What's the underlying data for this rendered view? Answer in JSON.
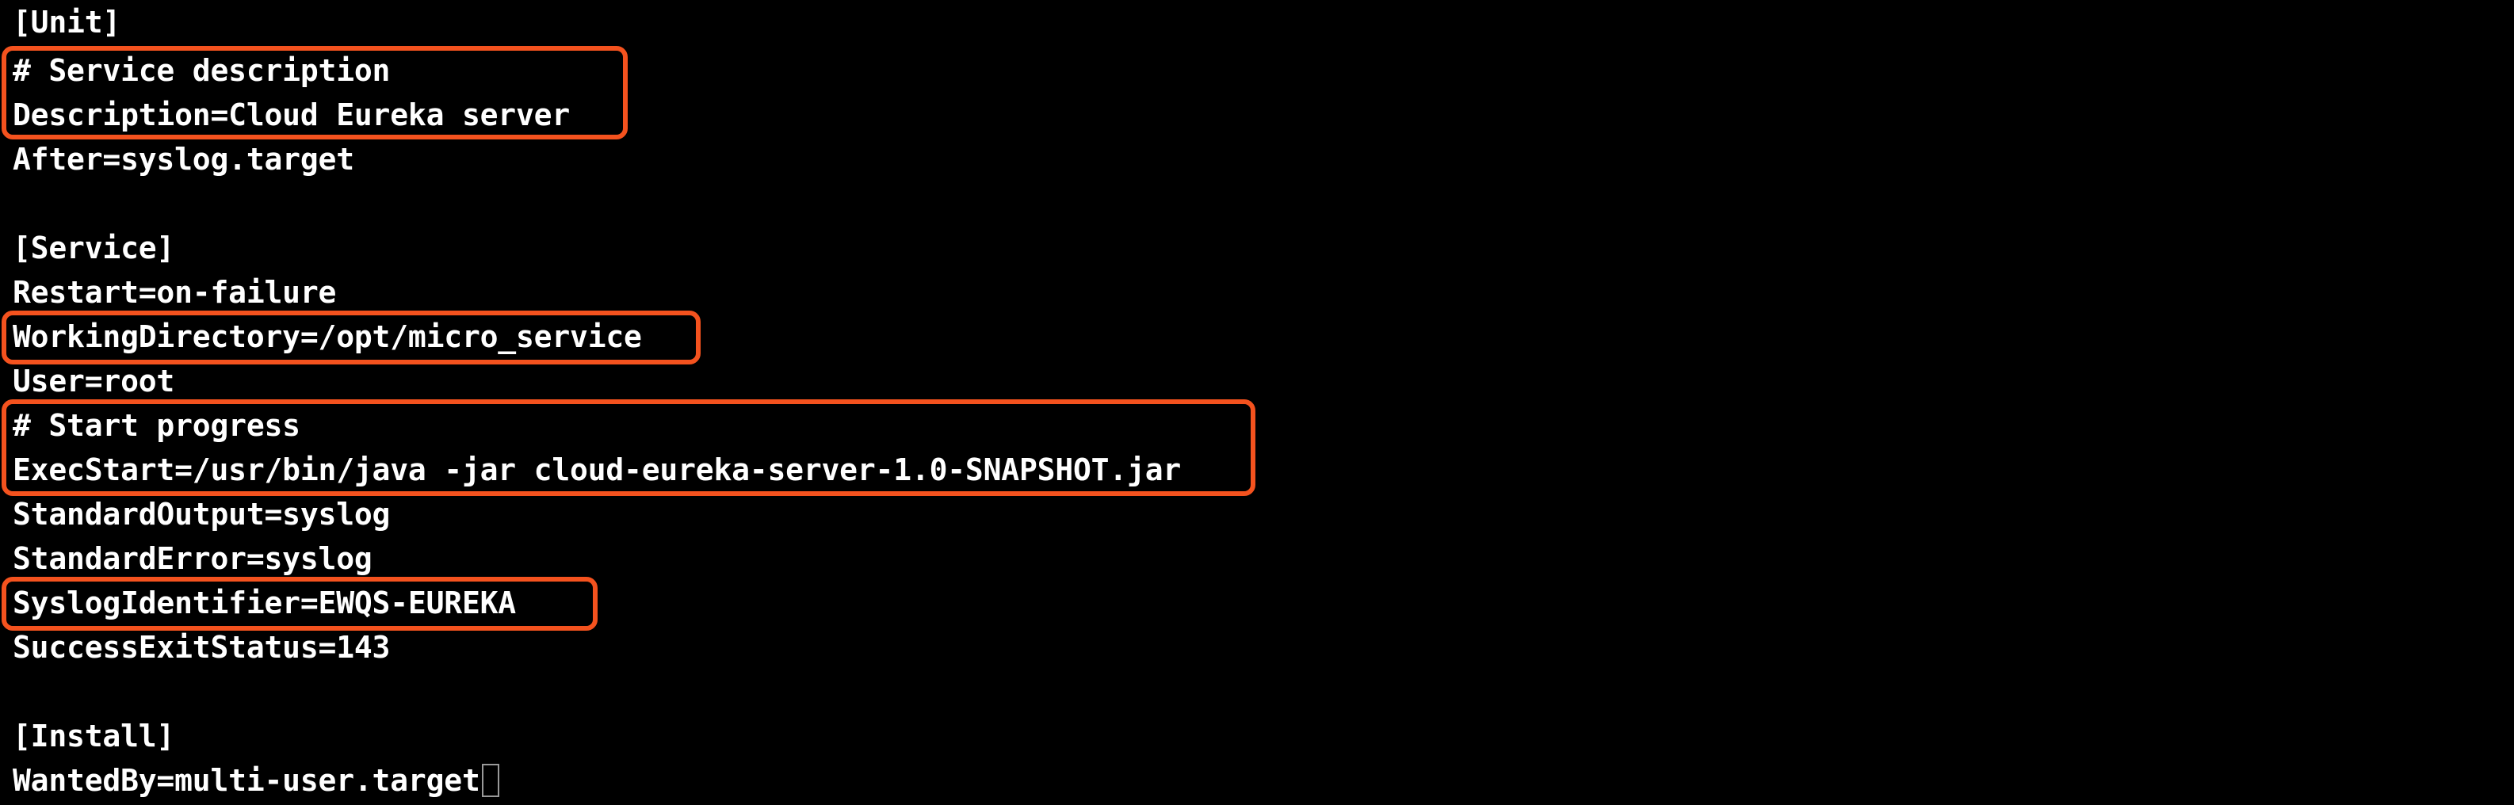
{
  "terminal": {
    "lines": [
      "[Unit]",
      "# Service description",
      "Description=Cloud Eureka server",
      "After=syslog.target",
      "",
      "[Service]",
      "Restart=on-failure",
      "WorkingDirectory=/opt/micro_service",
      "User=root",
      "# Start progress",
      "ExecStart=/usr/bin/java -jar cloud-eureka-server-1.0-SNAPSHOT.jar",
      "StandardOutput=syslog",
      "StandardError=syslog",
      "SyslogIdentifier=EWQS-EUREKA",
      "SuccessExitStatus=143",
      "",
      "[Install]",
      "WantedBy=multi-user.target"
    ]
  },
  "colors": {
    "background": "#000000",
    "text": "#ffffff",
    "highlight_border": "#f4521e",
    "cursor_border": "#9a9a9a"
  }
}
